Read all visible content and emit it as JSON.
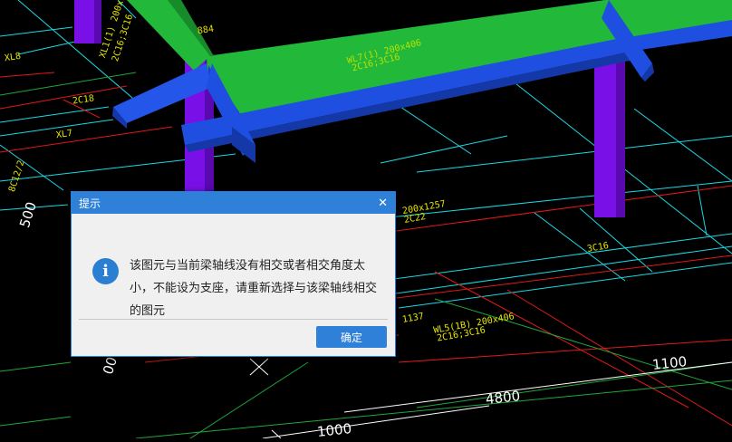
{
  "dialog": {
    "title": "提示",
    "close_symbol": "✕",
    "message": "该图元与当前梁轴线没有相交或者相交角度太小，不能设为支座，请重新选择与该梁轴线相交的图元",
    "ok_label": "确定",
    "icon": "info-icon",
    "icon_glyph": "i"
  },
  "cad_labels": {
    "xl8": "XL8",
    "xl7": "XL7",
    "xl1": "XL1(1) 200x1064",
    "xl1_rebar": "2C16;3C16",
    "id_884": "884",
    "c18": "2C18",
    "wl_main": "WL7(1) 200x406",
    "wl_main_rebar": "2C16;3C16",
    "wl5": "WL5(1B) 200x406",
    "wl5_rebar": "2C16;3C16",
    "beam_1257": "200x1257",
    "beam_1257_rebar": "2C22",
    "left_rebar": "8C12/2",
    "label_1137": "1137",
    "label_3c16": "3C16"
  },
  "dimensions": {
    "d1100": "1100",
    "d4800": "4800",
    "d1000": "1000",
    "d500": "500",
    "d00": "00"
  },
  "colors": {
    "background": "#000000",
    "beam_green": "#22b83a",
    "beam_blue": "#1f4fe0",
    "column_purple": "#7a10e8",
    "grid_cyan": "#19d9e6",
    "grid_red": "#e01818",
    "grid_green": "#1fa83a",
    "text_yellow": "#e6e600",
    "dialog_accent": "#2e80d8"
  }
}
